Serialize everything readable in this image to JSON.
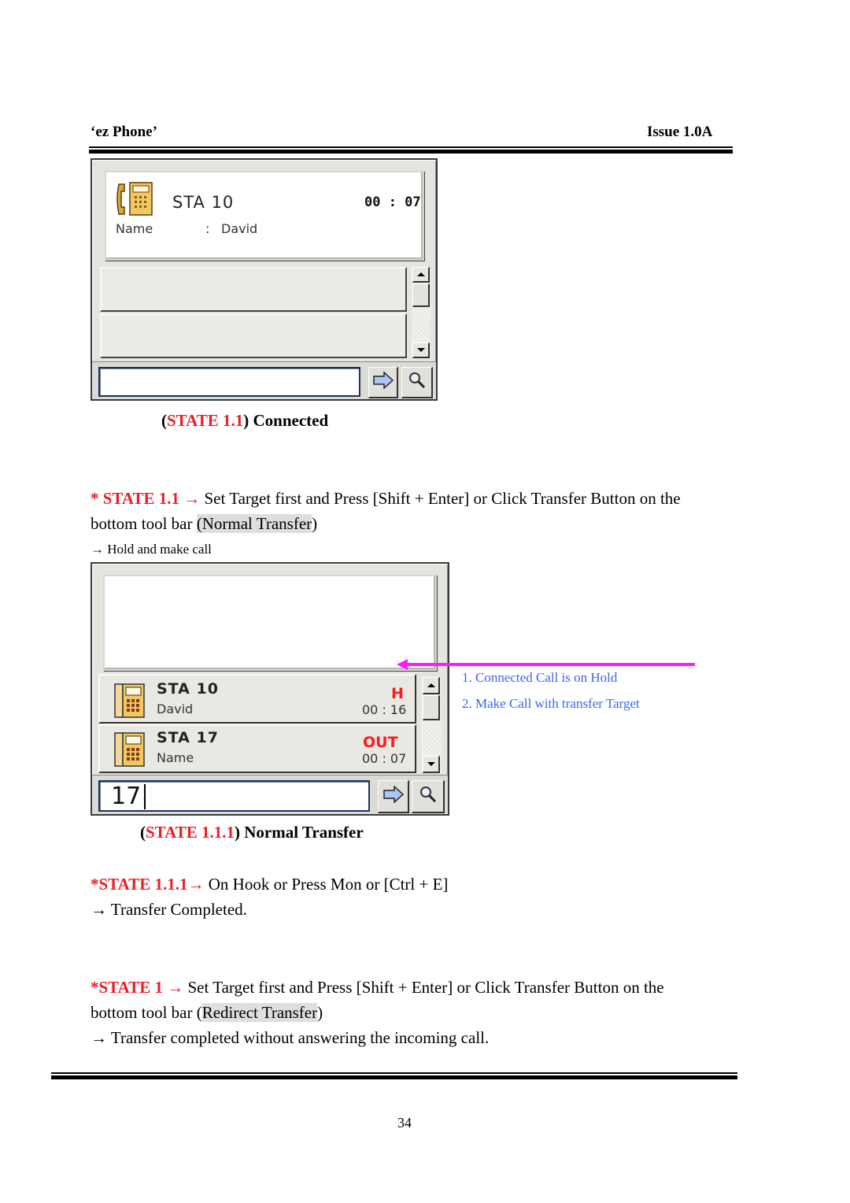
{
  "header": {
    "title": "‘ez Phone’",
    "issue": "Issue 1.0A"
  },
  "figure1": {
    "display": {
      "station": "STA  10",
      "timer": "00 : 07",
      "name_label": "Name",
      "name_separator": ":",
      "name_value": "David",
      "icon": "phone-handset-icon"
    },
    "call_rows": [
      {
        "empty": true
      },
      {
        "empty": true
      }
    ],
    "input": {
      "value": "",
      "placeholder": ""
    },
    "buttons": {
      "dial": "arrow-right-icon",
      "search": "magnifier-icon"
    },
    "caption": {
      "open": "(",
      "state": "STATE 1.1",
      "close": ")",
      "label": " Connected"
    }
  },
  "section1": {
    "prefix": "* STATE 1.1 ",
    "arrow": "→",
    "text_line1": " Set Target first and Press [Shift + Enter] or Click Transfer Button on the",
    "text_line2_pre": "bottom tool bar ",
    "highlight": "(Normal Transfer",
    "text_line2_post": ")",
    "note_arrow": "→",
    "note": " Hold and make call"
  },
  "figure2": {
    "display": {
      "empty": true
    },
    "call_rows": [
      {
        "station": "STA  10",
        "name": "David",
        "status": "H",
        "timer": "00 : 16"
      },
      {
        "station": "STA  17",
        "name": "Name",
        "status": "OUT",
        "timer": "00 : 07"
      }
    ],
    "input": {
      "value": "17"
    },
    "annotations": [
      "1. Connected Call is on Hold",
      "2. Make Call with transfer Target"
    ],
    "colors": {
      "pointer_arrow": "#ff1aff",
      "annotation": "#3a66f0",
      "status": "#ff1a1a"
    },
    "caption": {
      "open": "(",
      "state": "STATE 1.1.1",
      "close": ")",
      "label": " Normal Transfer"
    }
  },
  "section2": {
    "prefix": "*STATE 1.1.1",
    "arrow": "→",
    "text": " On Hook or Press Mon or [Ctrl + E]",
    "result_arrow": "→",
    "result": " Transfer Completed."
  },
  "section3": {
    "prefix": "*STATE 1 ",
    "arrow": "→",
    "text_line1": " Set Target first and Press [Shift + Enter] or Click Transfer Button on the",
    "text_line2_pre": "bottom tool bar (",
    "highlight": "Redirect Transfer",
    "text_line2_post": ")",
    "result_arrow": "→",
    "result": " Transfer completed without answering the incoming call."
  },
  "footer": {
    "page_number": "34"
  },
  "colors": {
    "state_red": "#ee1c25",
    "highlight_gray": "#dedede"
  }
}
